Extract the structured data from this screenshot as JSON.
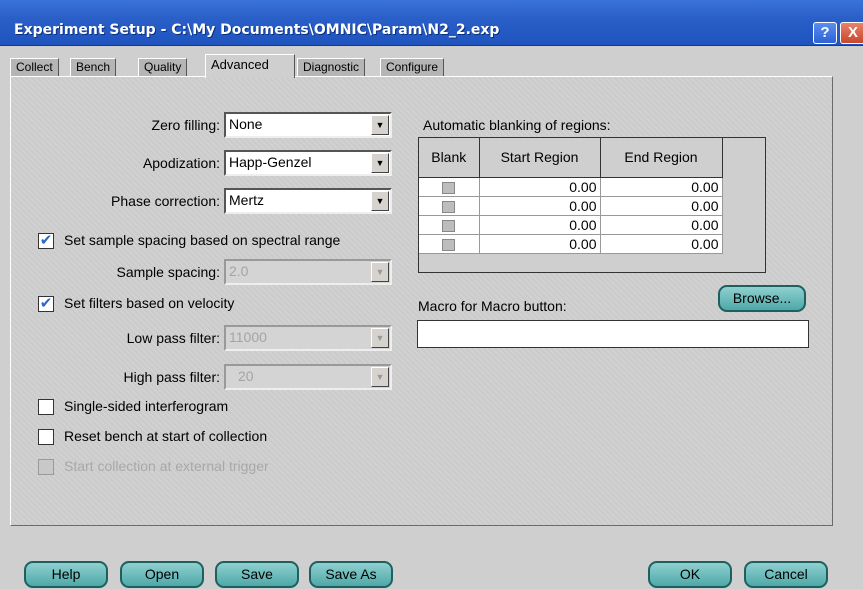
{
  "window": {
    "title": "Experiment Setup - C:\\My Documents\\OMNIC\\Param\\N2_2.exp",
    "help_symbol": "?",
    "close_symbol": "X"
  },
  "tabs": [
    "Collect",
    "Bench",
    "Quality",
    "Advanced",
    "Diagnostic",
    "Configure"
  ],
  "active_tab": "Advanced",
  "left": {
    "zero_filling": {
      "label": "Zero filling:",
      "value": "None"
    },
    "apodization": {
      "label": "Apodization:",
      "value": "Happ-Genzel"
    },
    "phase_correction": {
      "label": "Phase correction:",
      "value": "Mertz"
    },
    "set_sample_spacing": {
      "label": "Set sample spacing based on spectral range",
      "checked": true
    },
    "sample_spacing": {
      "label": "Sample spacing:",
      "value": "2.0"
    },
    "set_filters": {
      "label": "Set filters based on velocity",
      "checked": true
    },
    "low_pass": {
      "label": "Low pass filter:",
      "value": "11000"
    },
    "high_pass": {
      "label": "High pass filter:",
      "value": "20"
    },
    "single_sided": {
      "label": "Single-sided interferogram",
      "checked": false
    },
    "reset_bench": {
      "label": "Reset bench at start of collection",
      "checked": false
    },
    "external_trigger": {
      "label": "Start collection at external trigger",
      "checked": false
    }
  },
  "blanking": {
    "title": "Automatic blanking of regions:",
    "columns": [
      "Blank",
      "Start Region",
      "End Region"
    ],
    "rows": [
      {
        "start": "0.00",
        "end": "0.00"
      },
      {
        "start": "0.00",
        "end": "0.00"
      },
      {
        "start": "0.00",
        "end": "0.00"
      },
      {
        "start": "0.00",
        "end": "0.00"
      }
    ]
  },
  "macro": {
    "label": "Macro for Macro button:",
    "browse": "Browse...",
    "value": ""
  },
  "buttons": {
    "help": "Help",
    "open": "Open",
    "save": "Save",
    "save_as": "Save As",
    "ok": "OK",
    "cancel": "Cancel"
  },
  "icons": {
    "dropdown": "▼",
    "check": "✔"
  }
}
